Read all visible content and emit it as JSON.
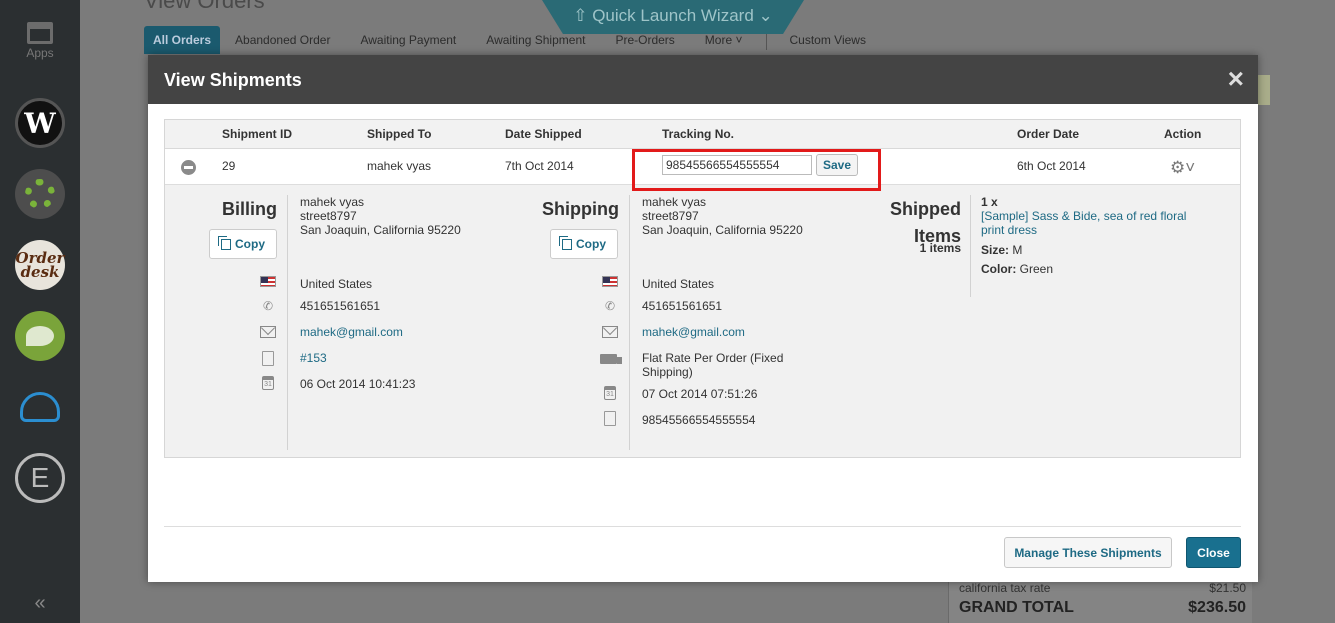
{
  "sidebar": {
    "apps_label": "Apps",
    "app_icons": [
      "w-app-icon",
      "gear-app-icon",
      "order-desk-icon",
      "green-leaf-app-icon",
      "cloud-app-icon",
      "e-app-icon"
    ],
    "order_desk_label": "Order desk",
    "w_label": "W",
    "e_label": "E",
    "collapse_label": "«"
  },
  "background": {
    "page_title": "View Orders",
    "wizard_label": "Quick Launch Wizard",
    "tabs": [
      "All Orders",
      "Abandoned Order",
      "Awaiting Payment",
      "Awaiting Shipment",
      "Pre-Orders",
      "More"
    ],
    "custom_views_label": "Custom Views",
    "tax_label": "california tax rate",
    "tax_value": "$21.50",
    "grand_total_label": "GRAND TOTAL",
    "grand_total_value": "$236.50"
  },
  "modal": {
    "title": "View Shipments",
    "close_icon": "×",
    "columns": {
      "shipment_id": "Shipment ID",
      "shipped_to": "Shipped To",
      "date_shipped": "Date Shipped",
      "tracking_no": "Tracking No.",
      "order_date": "Order Date",
      "action": "Action"
    },
    "row": {
      "shipment_id": "29",
      "shipped_to": "mahek vyas",
      "date_shipped": "7th Oct 2014",
      "tracking_value": "98545566554555554",
      "save_label": "Save",
      "order_date": "6th Oct 2014",
      "action_icon": "⚙˅"
    },
    "billing": {
      "title": "Billing",
      "copy_label": "Copy",
      "name": "mahek vyas",
      "street": "street8797",
      "city": "San Joaquin, California 95220",
      "country": "United States",
      "phone": "451651561651",
      "email": "mahek@gmail.com",
      "order_ref": "#153",
      "datetime": "06 Oct 2014 10:41:23"
    },
    "shipping": {
      "title": "Shipping",
      "copy_label": "Copy",
      "name": "mahek vyas",
      "street": "street8797",
      "city": "San Joaquin, California 95220",
      "country": "United States",
      "phone": "451651561651",
      "email": "mahek@gmail.com",
      "method_line1": "Flat Rate Per Order (Fixed",
      "method_line2": "Shipping)",
      "datetime": "07 Oct 2014 07:51:26",
      "tracking": "98545566554555554"
    },
    "items": {
      "title_line1": "Shipped",
      "title_line2": "Items",
      "count": "1 items",
      "qty": "1 x",
      "product_line1": "[Sample] Sass & Bide, sea of red floral",
      "product_line2": "print dress",
      "size_label": "Size:",
      "size_value": "M",
      "color_label": "Color:",
      "color_value": "Green"
    },
    "manage_label": "Manage These Shipments",
    "close_label": "Close"
  }
}
